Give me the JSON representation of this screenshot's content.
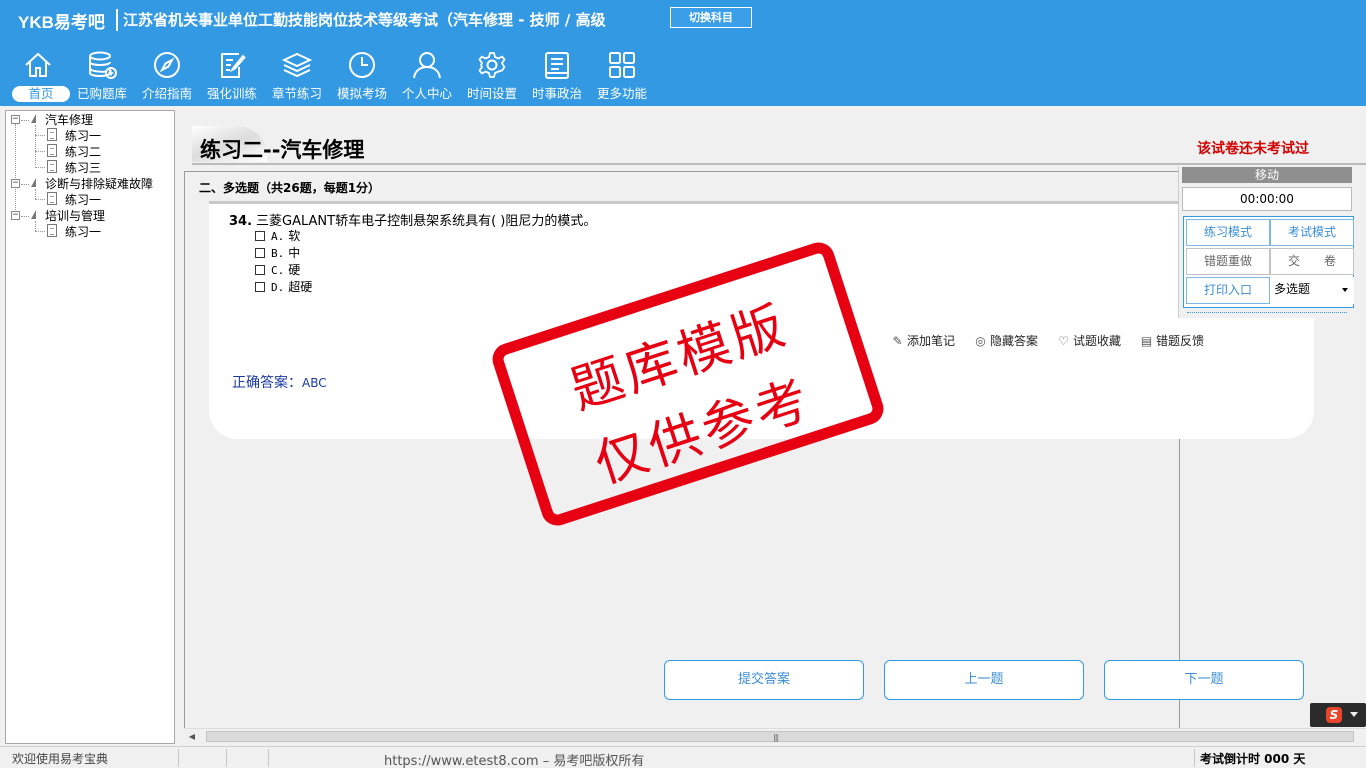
{
  "header": {
    "brand": "YKB易考吧",
    "exam_title": "江苏省机关事业单位工勤技能岗位技术等级考试（汽车修理 - 技师 / 高级",
    "switch_subject": "切换科目"
  },
  "nav": [
    {
      "label": "首页",
      "icon": "home-icon",
      "active": true
    },
    {
      "label": "已购题库",
      "icon": "database-icon"
    },
    {
      "label": "介绍指南",
      "icon": "compass-icon"
    },
    {
      "label": "强化训练",
      "icon": "edit-icon"
    },
    {
      "label": "章节练习",
      "icon": "layers-icon"
    },
    {
      "label": "模拟考场",
      "icon": "clock-icon"
    },
    {
      "label": "个人中心",
      "icon": "user-icon"
    },
    {
      "label": "时间设置",
      "icon": "gear-icon"
    },
    {
      "label": "时事政治",
      "icon": "news-icon"
    },
    {
      "label": "更多功能",
      "icon": "grid-icon"
    }
  ],
  "tree": {
    "groups": [
      {
        "label": "汽车修理",
        "items": [
          "练习一",
          "练习二",
          "练习三"
        ]
      },
      {
        "label": "诊断与排除疑难故障",
        "items": [
          "练习一"
        ]
      },
      {
        "label": "培训与管理",
        "items": [
          "练习一"
        ]
      }
    ]
  },
  "main": {
    "paper_title": "练习二--汽车修理",
    "not_taken_notice": "该试卷还未考试过",
    "section_title": "二、多选题（共26题，每题1分）",
    "question": {
      "number": "34.",
      "text": "三菱GALANT轿车电子控制悬架系统具有( )阻尼力的模式。",
      "options": [
        {
          "letter": "A.",
          "text": "软"
        },
        {
          "letter": "B.",
          "text": "中"
        },
        {
          "letter": "C.",
          "text": "硬"
        },
        {
          "letter": "D.",
          "text": "超硬"
        }
      ],
      "actions": {
        "add_note": "添加笔记",
        "hide_answer": "隐藏答案",
        "favorite": "试题收藏",
        "feedback": "错题反馈"
      },
      "answer_label": "正确答案：",
      "answer_value": "ABC"
    },
    "buttons": {
      "submit": "提交答案",
      "prev": "上一题",
      "next": "下一题"
    }
  },
  "right_panel": {
    "move": "移动",
    "timer": "00:00:00",
    "practice_mode": "练习模式",
    "exam_mode": "考试模式",
    "redo_wrong": "错题重做",
    "hand_in": "交　　卷",
    "print": "打印入口",
    "question_type": "多选题"
  },
  "watermark": {
    "line1": "题库模版",
    "line2": "仅供参考"
  },
  "status": {
    "welcome": "欢迎使用易考宝典",
    "url": "https://www.etest8.com – 易考吧版权所有",
    "countdown": "考试倒计时 000 天"
  },
  "colors": {
    "header_bg": "#3399e3",
    "accent": "#3399e3",
    "notice_red": "#d20000",
    "stamp_red": "#e60012",
    "answer_blue": "#1a3aa0"
  }
}
